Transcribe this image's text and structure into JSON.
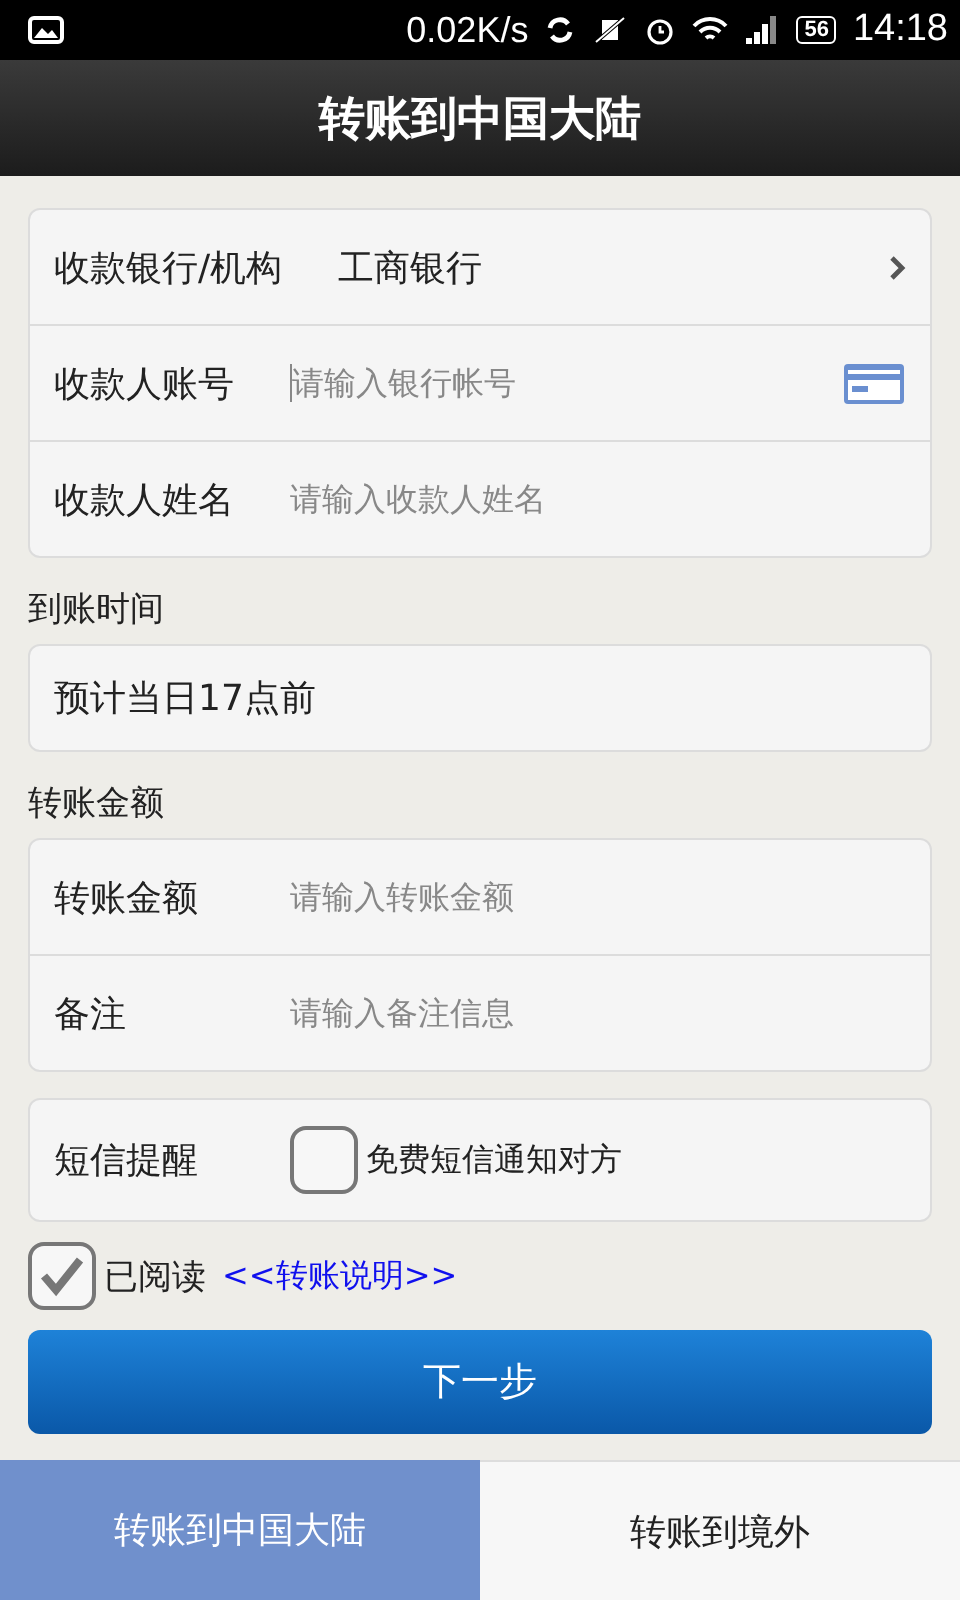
{
  "status_bar": {
    "speed": "0.02K/s",
    "battery": "56",
    "time": "14:18"
  },
  "title": "转账到中国大陆",
  "recipient": [
    {
      "kind": "select",
      "label": "收款银行/机构",
      "value": "工商银行"
    },
    {
      "kind": "card",
      "label": "收款人账号",
      "placeholder": "请输入银行帐号"
    },
    {
      "kind": "input",
      "label": "收款人姓名",
      "placeholder": "请输入收款人姓名"
    }
  ],
  "arrival": {
    "heading": "到账时间",
    "value": "预计当日17点前"
  },
  "amount": {
    "heading": "转账金额",
    "rows": [
      {
        "kind": "input",
        "label": "转账金额",
        "placeholder": "请输入转账金额"
      },
      {
        "kind": "input",
        "label": "备注",
        "placeholder": "请输入备注信息"
      }
    ]
  },
  "sms": {
    "label": "短信提醒",
    "option": "免费短信通知对方",
    "checked": false
  },
  "agreement": {
    "label": "已阅读",
    "link": "<<转账说明>>",
    "checked": true
  },
  "next_button": "下一步",
  "tabs": [
    {
      "label": "转账到中国大陆",
      "selected": true
    },
    {
      "label": "转账到境外",
      "selected": false
    }
  ]
}
